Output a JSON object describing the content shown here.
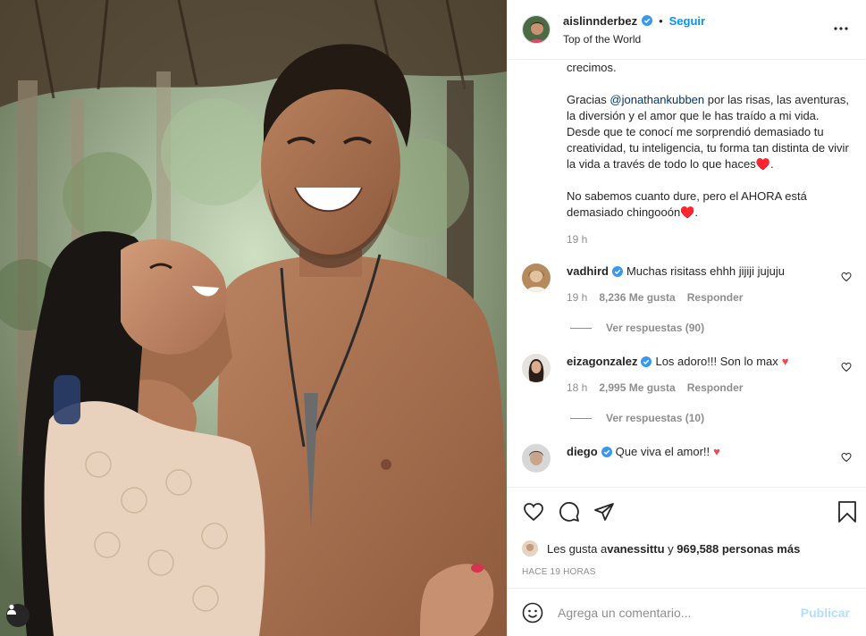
{
  "header": {
    "username": "aislinnderbez",
    "follow_label": "Seguir",
    "location": "Top of the World",
    "separator": "•"
  },
  "caption": {
    "paragraph_fragment": "crecimos.",
    "p2_before": "Gracias ",
    "p2_mention": "@jonathankubben",
    "p2_after": " por las risas, las aventuras, la diversión y el amor que le has traído a mi vida. Desde que te conocí me sorprendió demasiado tu creatividad, tu inteligencia, tu forma tan distinta de vivir la vida a través de todo lo que haces♥️.",
    "p3": "No sabemos cuanto dure, pero el AHORA está demasiado chingooón♥️.",
    "time": "19 h"
  },
  "comments": [
    {
      "user": "vadhird",
      "text": "Muchas risitass ehhh jijiji jujuju",
      "heart": "",
      "time": "19 h",
      "likes": "8,236 Me gusta",
      "reply_label": "Responder",
      "view_replies": "Ver respuestas (90)"
    },
    {
      "user": "eizagonzalez",
      "text": "Los adoro!!! Son lo max",
      "heart": "♥",
      "time": "18 h",
      "likes": "2,995 Me gusta",
      "reply_label": "Responder",
      "view_replies": "Ver respuestas (10)"
    },
    {
      "user": "diego",
      "text": "Que viva el amor!!",
      "heart": "♥"
    }
  ],
  "likes": {
    "prefix": "Les gusta a ",
    "user": "vanessittu",
    "middle": " y ",
    "count": "969,588 personas más"
  },
  "time_ago": "HACE 19 HORAS",
  "add_comment": {
    "placeholder": "Agrega un comentario...",
    "publish_label": "Publicar"
  },
  "icons": {
    "more": "more-horizontal-icon",
    "like": "heart-icon",
    "comment": "comment-icon",
    "share": "paper-plane-icon",
    "save": "bookmark-icon",
    "emoji": "emoji-icon",
    "tag": "user-tag-icon",
    "verified": "verified-badge-icon"
  },
  "colors": {
    "accent": "#0095f6",
    "verified": "#3897f0",
    "heart": "#ed4956",
    "muted": "#8e8e8e"
  }
}
